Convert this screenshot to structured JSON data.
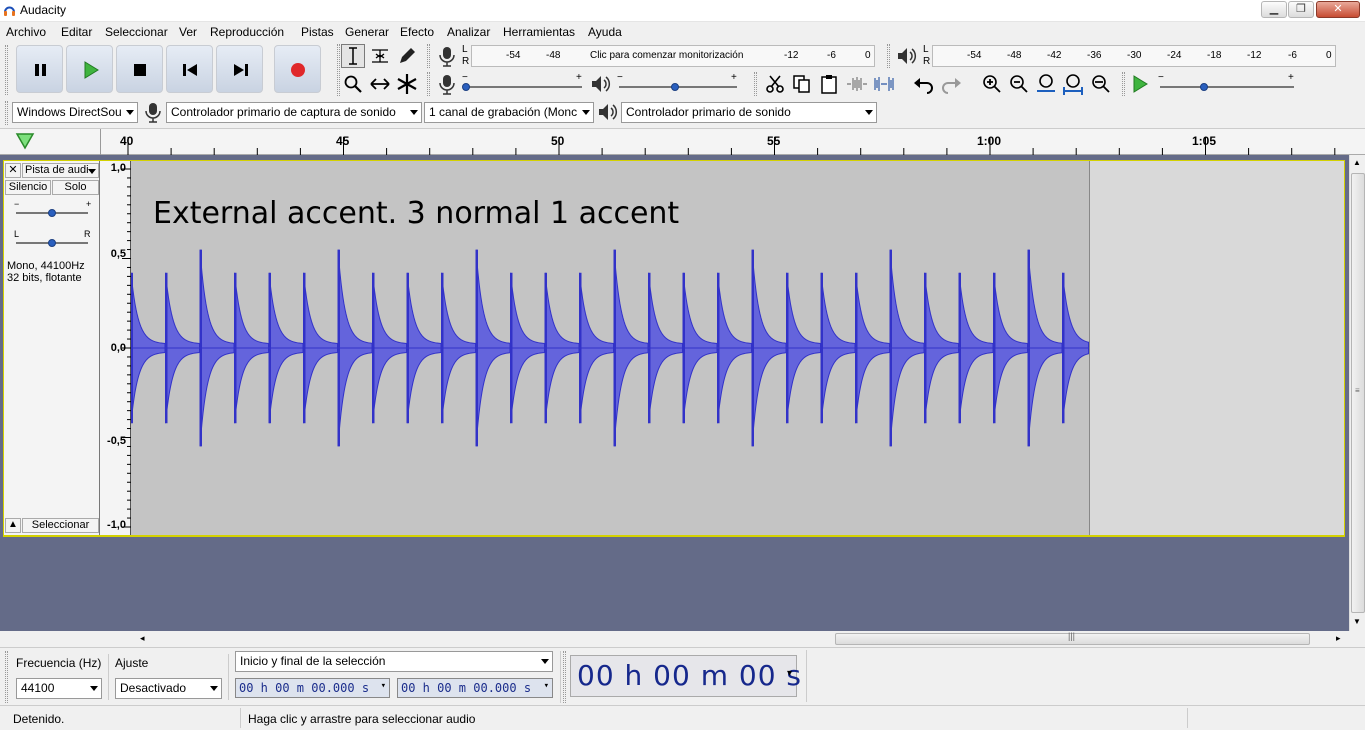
{
  "window": {
    "title": "Audacity"
  },
  "menu": [
    "Archivo",
    "Editar",
    "Seleccionar",
    "Ver",
    "Reproducción",
    "Pistas",
    "Generar",
    "Efecto",
    "Analizar",
    "Herramientas",
    "Ayuda"
  ],
  "transport": {
    "buttons": [
      "pause",
      "play",
      "stop",
      "skip-start",
      "skip-end",
      "record"
    ]
  },
  "meters": {
    "record_scale": [
      "-54",
      "-48",
      "-12",
      "-6",
      "0"
    ],
    "record_hint": "Clic para comenzar monitorización",
    "play_scale": [
      "-54",
      "-48",
      "-42",
      "-36",
      "-30",
      "-24",
      "-18",
      "-12",
      "-6",
      "0"
    ],
    "lr": [
      "L",
      "R"
    ]
  },
  "device": {
    "host": "Windows DirectSou",
    "input": "Controlador primario de captura de sonido",
    "channels": "1 canal de grabación (Monc",
    "output": "Controlador primario de sonido"
  },
  "ruler": {
    "labels": [
      "40",
      "45",
      "50",
      "55",
      "1:00",
      "1:05"
    ]
  },
  "track": {
    "name": "Pista de audi",
    "mute": "Silencio",
    "solo": "Solo",
    "gain_minus": "−",
    "gain_plus": "+",
    "pan_left": "L",
    "pan_right": "R",
    "info_line1": "Mono, 44100Hz",
    "info_line2": "32 bits, flotante",
    "select": "Seleccionar",
    "clip_label": "External accent. 3 normal 1 accent",
    "vruler": [
      "1,0",
      "0,5",
      "0,0",
      "-0,5",
      "-1,0"
    ],
    "wave_color": "#3232c8",
    "wave_fill": "#6464dc"
  },
  "selection_bar": {
    "rate_label": "Frecuencia (Hz)",
    "rate_value": "44100",
    "snap_label": "Ajuste",
    "snap_value": "Desactivado",
    "mode": "Inicio y final de la selección",
    "start": "00 h 00 m 00.000 s",
    "end": "00 h 00 m 00.000 s",
    "audio_position": "00 h 00 m 00 s"
  },
  "status": {
    "left": "Detenido.",
    "right": "Haga clic y arrastre para seleccionar audio"
  }
}
